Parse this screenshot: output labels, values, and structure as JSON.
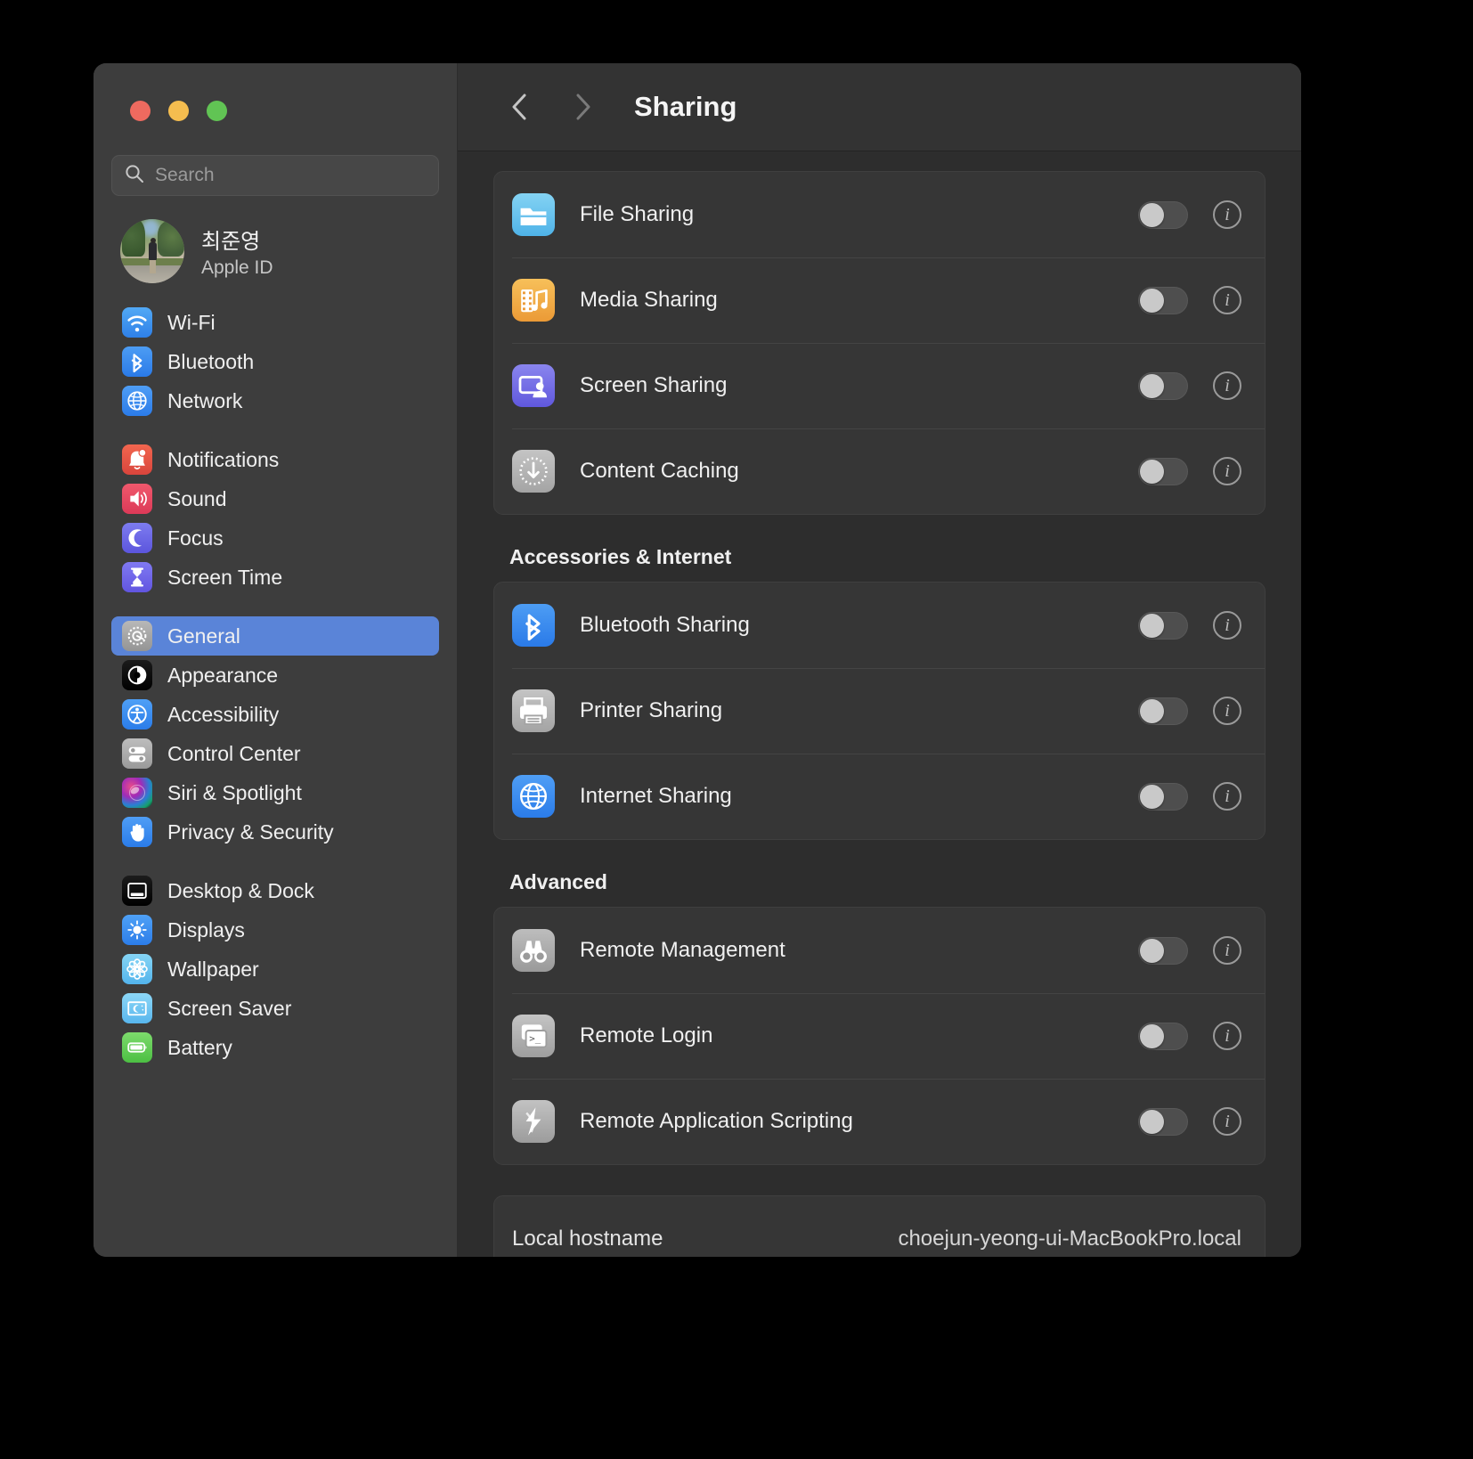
{
  "window": {
    "traffic_lights": [
      "close",
      "minimize",
      "zoom"
    ]
  },
  "search": {
    "placeholder": "Search",
    "value": "",
    "icon": "search-icon"
  },
  "account": {
    "name": "최준영",
    "subtitle": "Apple ID",
    "avatar": "user-avatar"
  },
  "sidebar": {
    "groups": [
      {
        "items": [
          {
            "label": "Wi-Fi",
            "icon": "wifi-icon",
            "selected": false
          },
          {
            "label": "Bluetooth",
            "icon": "bluetooth-icon",
            "selected": false
          },
          {
            "label": "Network",
            "icon": "globe-icon",
            "selected": false
          }
        ]
      },
      {
        "items": [
          {
            "label": "Notifications",
            "icon": "bell-icon",
            "selected": false
          },
          {
            "label": "Sound",
            "icon": "speaker-icon",
            "selected": false
          },
          {
            "label": "Focus",
            "icon": "moon-icon",
            "selected": false
          },
          {
            "label": "Screen Time",
            "icon": "hourglass-icon",
            "selected": false
          }
        ]
      },
      {
        "items": [
          {
            "label": "General",
            "icon": "gear-icon",
            "selected": true
          },
          {
            "label": "Appearance",
            "icon": "appearance-icon",
            "selected": false
          },
          {
            "label": "Accessibility",
            "icon": "accessibility-icon",
            "selected": false
          },
          {
            "label": "Control Center",
            "icon": "sliders-icon",
            "selected": false
          },
          {
            "label": "Siri & Spotlight",
            "icon": "siri-icon",
            "selected": false
          },
          {
            "label": "Privacy & Security",
            "icon": "hand-icon",
            "selected": false
          }
        ]
      },
      {
        "items": [
          {
            "label": "Desktop & Dock",
            "icon": "desktop-icon",
            "selected": false
          },
          {
            "label": "Displays",
            "icon": "brightness-icon",
            "selected": false
          },
          {
            "label": "Wallpaper",
            "icon": "flower-icon",
            "selected": false
          },
          {
            "label": "Screen Saver",
            "icon": "screensaver-icon",
            "selected": false
          },
          {
            "label": "Battery",
            "icon": "battery-icon",
            "selected": false
          }
        ]
      }
    ]
  },
  "toolbar": {
    "back_icon": "chevron-left-icon",
    "forward_icon": "chevron-right-icon",
    "title": "Sharing"
  },
  "main": {
    "sections": [
      {
        "heading": "",
        "rows": [
          {
            "label": "File Sharing",
            "icon": "folder-icon",
            "enabled": false,
            "info": "info-icon"
          },
          {
            "label": "Media Sharing",
            "icon": "media-icon",
            "enabled": false,
            "info": "info-icon"
          },
          {
            "label": "Screen Sharing",
            "icon": "screenshare-icon",
            "enabled": false,
            "info": "info-icon"
          },
          {
            "label": "Content Caching",
            "icon": "contentcache-icon",
            "enabled": false,
            "info": "info-icon"
          }
        ]
      },
      {
        "heading": "Accessories & Internet",
        "rows": [
          {
            "label": "Bluetooth Sharing",
            "icon": "bluetooth-icon",
            "enabled": false,
            "info": "info-icon"
          },
          {
            "label": "Printer Sharing",
            "icon": "printer-icon",
            "enabled": false,
            "info": "info-icon"
          },
          {
            "label": "Internet Sharing",
            "icon": "globe-icon",
            "enabled": false,
            "info": "info-icon"
          }
        ]
      },
      {
        "heading": "Advanced",
        "rows": [
          {
            "label": "Remote Management",
            "icon": "binoculars-icon",
            "enabled": false,
            "info": "info-icon"
          },
          {
            "label": "Remote Login",
            "icon": "terminal-icon",
            "enabled": false,
            "info": "info-icon"
          },
          {
            "label": "Remote Application Scripting",
            "icon": "script-icon",
            "enabled": false,
            "info": "info-icon"
          }
        ]
      }
    ],
    "hostname_row": {
      "label": "Local hostname",
      "value": "choejun-yeong-ui-MacBookPro.local"
    }
  },
  "colors": {
    "accent": "#5a84d8",
    "window_bg": "#2d2d2d",
    "sidebar_bg": "#3d3d3d",
    "card_bg": "#363636"
  }
}
